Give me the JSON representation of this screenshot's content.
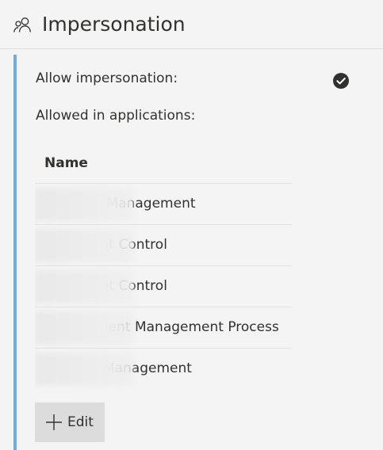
{
  "header": {
    "title": "Impersonation",
    "icon": "users-icon"
  },
  "accent_color": "#71aee0",
  "properties": {
    "allow_impersonation_label": "Allow impersonation:",
    "allow_impersonation_value": "checked",
    "allowed_in_applications_label": "Allowed in applications:"
  },
  "table": {
    "columns": [
      "Name"
    ],
    "rows": [
      {
        "name": "Contract Management"
      },
      {
        "name": "Document Control"
      },
      {
        "name": "Document Control"
      },
      {
        "name": "Environment Management Process"
      },
      {
        "name": "Incident Management"
      }
    ]
  },
  "actions": {
    "edit_label": "Edit"
  }
}
